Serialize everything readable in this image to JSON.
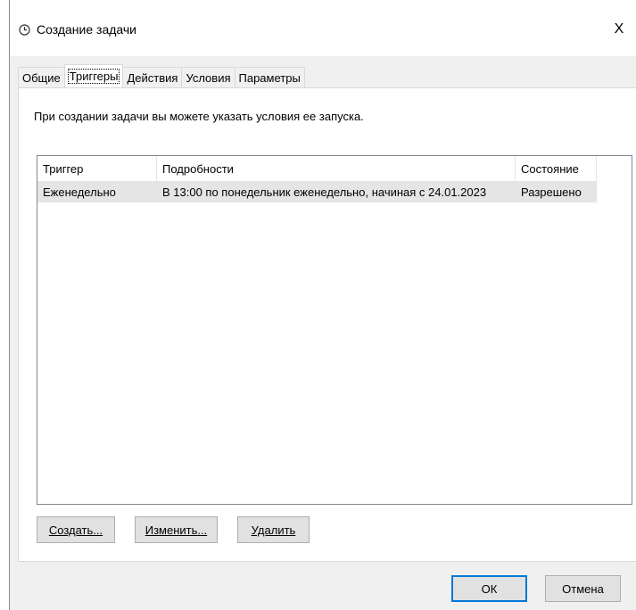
{
  "window": {
    "title": "Создание задачи",
    "close_symbol": "X",
    "title_icon": "clock-icon"
  },
  "tabs": [
    {
      "label": "Общие",
      "active": false
    },
    {
      "label": "Триггеры",
      "active": true
    },
    {
      "label": "Действия",
      "active": false
    },
    {
      "label": "Условия",
      "active": false
    },
    {
      "label": "Параметры",
      "active": false
    }
  ],
  "panel": {
    "description": "При создании задачи вы можете указать условия ее запуска."
  },
  "triggers_table": {
    "columns": [
      "Триггер",
      "Подробности",
      "Состояние"
    ],
    "rows": [
      {
        "trigger": "Еженедельно",
        "details": "В 13:00 по понедельник еженедельно, начиная с 24.01.2023",
        "status": "Разрешено"
      }
    ]
  },
  "buttons": {
    "create": "Создать...",
    "edit": "Изменить...",
    "delete": "Удалить",
    "ok": "ОК",
    "cancel": "Отмена"
  },
  "colors": {
    "window_bg": "#f0f0f0",
    "selected_row": "#e5e5e5",
    "default_button_border": "#0078d7"
  }
}
